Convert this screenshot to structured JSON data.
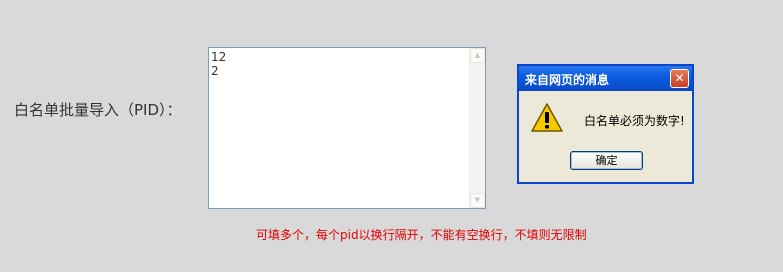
{
  "form": {
    "label": "白名单批量导入（PID）：",
    "textarea_lines": [
      "12",
      "2"
    ],
    "hint": "可填多个，每个pid以换行隔开，不能有空换行，不填则无限制"
  },
  "dialog": {
    "title": "来自网页的消息",
    "close_glyph": "✕",
    "icon": "warning-icon",
    "message": "白名单必须为数字!",
    "ok_label": "确定"
  },
  "colors": {
    "page_background": "#d9d9d9",
    "hint_text": "#e00000",
    "dialog_title_bar": "#0b5ce0",
    "dialog_body": "#ece9d8",
    "close_button": "#d0502c"
  }
}
